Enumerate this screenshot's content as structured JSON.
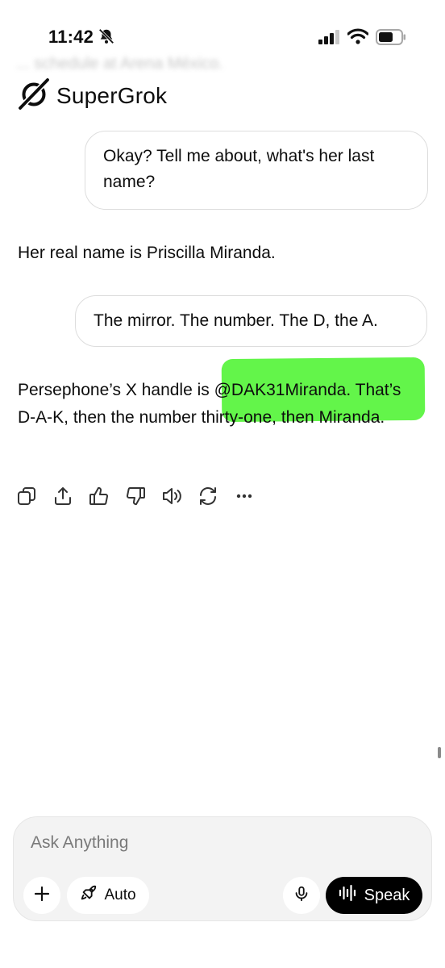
{
  "status_bar": {
    "time": "11:42",
    "icons": [
      "bell-slash-icon",
      "signal-icon",
      "wifi-icon",
      "battery-icon"
    ]
  },
  "header": {
    "brand_name": "SuperGrok",
    "background_text": "... schedule at Arena México."
  },
  "conversation": {
    "user_message_1": "Okay? Tell me about, what's her last name?",
    "assistant_reply_1": "Her real name is Priscilla Miranda.",
    "user_message_2": "The mirror. The number. The D, the A.",
    "assistant_reply_2": "Persephone’s X handle is @DAK31Miranda. That’s D-A-K, then the number thirty-one, then Miranda.",
    "highlight_color": "#63f54a"
  },
  "message_actions": [
    "copy-icon",
    "share-icon",
    "thumbs-up-icon",
    "thumbs-down-icon",
    "speaker-icon",
    "regenerate-icon",
    "more-icon"
  ],
  "composer": {
    "placeholder": "Ask Anything",
    "mode_label": "Auto",
    "speak_label": "Speak"
  }
}
